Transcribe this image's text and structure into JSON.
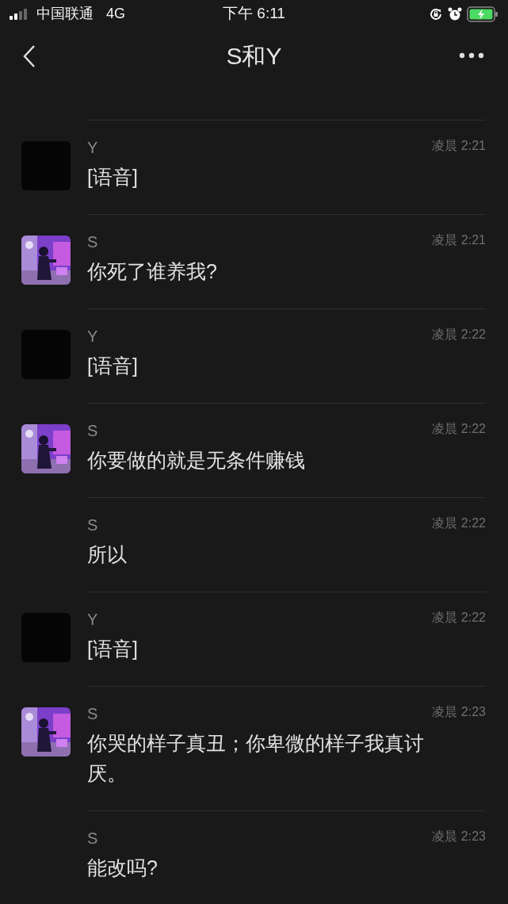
{
  "status_bar": {
    "carrier": "中国联通",
    "network": "4G",
    "time": "下午 6:11"
  },
  "nav": {
    "title": "S和Y"
  },
  "messages": [
    {
      "sender": "Y",
      "avatar": {
        "kind": "dark"
      },
      "time": "凌晨 2:21",
      "text": "[语音]"
    },
    {
      "sender": "S",
      "time": "凌晨 2:21",
      "text": "你死了谁养我?"
    },
    {
      "sender": "Y",
      "avatar": {
        "kind": "dark"
      },
      "time": "凌晨 2:22",
      "text": "[语音]"
    },
    {
      "sender": "S",
      "time": "凌晨 2:22",
      "text": "你要做的就是无条件赚钱"
    },
    {
      "sender": "S",
      "time": "凌晨 2:22",
      "text": "所以"
    },
    {
      "sender": "Y",
      "avatar": {
        "kind": "dark"
      },
      "time": "凌晨 2:22",
      "text": "[语音]"
    },
    {
      "sender": "S",
      "time": "凌晨 2:23",
      "text": "你哭的样子真丑；你卑微的样子我真讨厌。"
    },
    {
      "sender": "S",
      "time": "凌晨 2:23",
      "text": "能改吗?"
    }
  ]
}
